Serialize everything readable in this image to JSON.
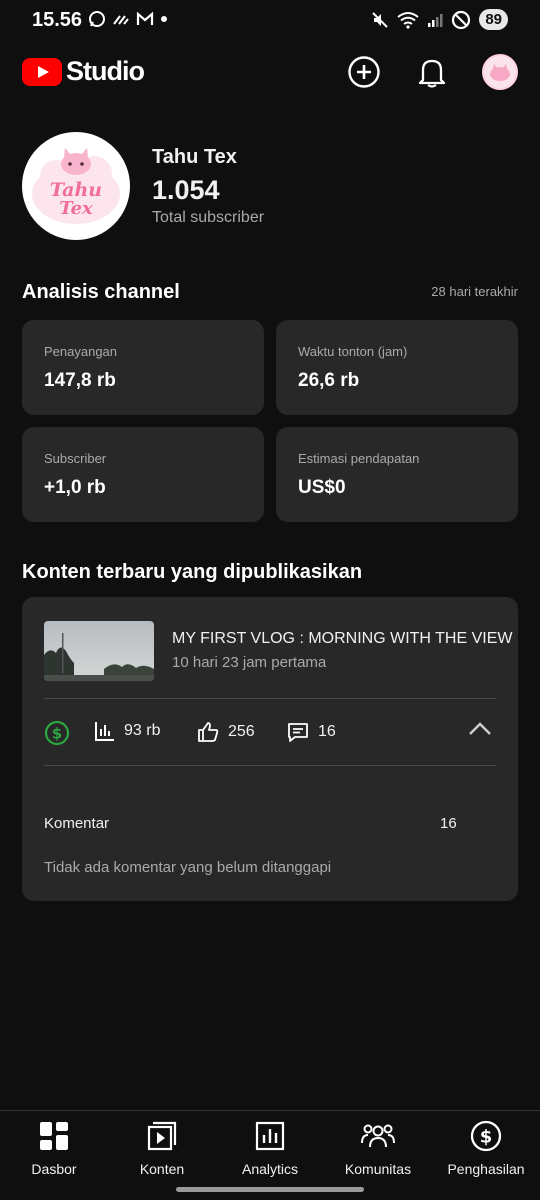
{
  "status_bar": {
    "time": "15.56",
    "battery": "89"
  },
  "header": {
    "logo_text": "Studio",
    "brand_color": "#ff0000"
  },
  "channel": {
    "name": "Tahu Tex",
    "subscriber_count": "1.054",
    "subscriber_label": "Total subscriber",
    "avatar_text_1": "Tahu",
    "avatar_text_2": "Tex"
  },
  "analytics": {
    "title": "Analisis channel",
    "period": "28 hari terakhir",
    "stats": [
      {
        "label": "Penayangan",
        "value": "147,8 rb"
      },
      {
        "label": "Waktu tonton (jam)",
        "value": "26,6 rb"
      },
      {
        "label": "Subscriber",
        "value": "+1,0 rb"
      },
      {
        "label": "Estimasi pendapatan",
        "value": "US$0"
      }
    ]
  },
  "recent": {
    "title": "Konten terbaru yang dipublikasikan",
    "video": {
      "title": "MY FIRST VLOG : MORNING WITH THE VIEW",
      "subtitle": "10 hari 23 jam pertama",
      "views": "93 rb",
      "likes": "256",
      "comments": "16"
    },
    "comments_label": "Komentar",
    "comments_count": "16",
    "comments_empty": "Tidak ada komentar yang belum ditanggapi",
    "monetization_color": "#2ba640"
  },
  "nav": {
    "items": [
      {
        "label": "Dasbor",
        "icon": "dashboard-icon"
      },
      {
        "label": "Konten",
        "icon": "content-icon"
      },
      {
        "label": "Analytics",
        "icon": "analytics-icon"
      },
      {
        "label": "Komunitas",
        "icon": "community-icon"
      },
      {
        "label": "Penghasilan",
        "icon": "earn-icon"
      }
    ]
  }
}
